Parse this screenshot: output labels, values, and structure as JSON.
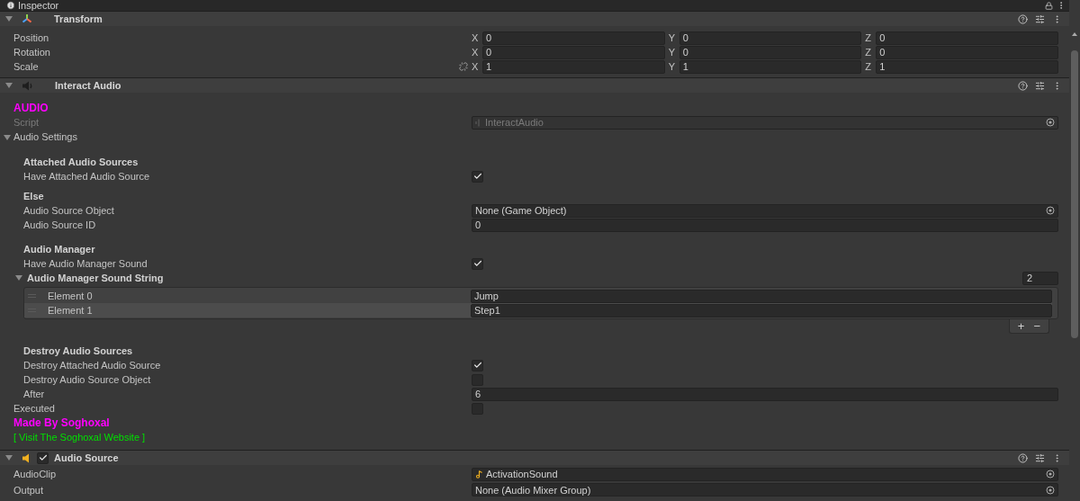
{
  "panel": {
    "title": "Inspector"
  },
  "components": [
    {
      "kind": "transform",
      "title": "Transform",
      "expanded": true,
      "vectors": [
        {
          "label": "Position",
          "linkable": false,
          "axes": [
            {
              "axis": "X",
              "value": "0"
            },
            {
              "axis": "Y",
              "value": "0"
            },
            {
              "axis": "Z",
              "value": "0"
            }
          ]
        },
        {
          "label": "Rotation",
          "linkable": false,
          "axes": [
            {
              "axis": "X",
              "value": "0"
            },
            {
              "axis": "Y",
              "value": "0"
            },
            {
              "axis": "Z",
              "value": "0"
            }
          ]
        },
        {
          "label": "Scale",
          "linkable": true,
          "axes": [
            {
              "axis": "X",
              "value": "1"
            },
            {
              "axis": "Y",
              "value": "1"
            },
            {
              "axis": "Z",
              "value": "1"
            }
          ]
        }
      ]
    },
    {
      "kind": "script",
      "title": "Interact Audio",
      "expanded": true,
      "items": [
        {
          "kind": "title",
          "text": "AUDIO"
        },
        {
          "kind": "script",
          "label": "Script",
          "value": "InteractAudio"
        },
        {
          "kind": "foldout",
          "label": "Audio Settings",
          "expanded": true,
          "children": [
            {
              "kind": "heading",
              "text": "Attached Audio Sources"
            },
            {
              "kind": "toggle",
              "label": "Have Attached Audio Source",
              "checked": true
            },
            {
              "kind": "heading",
              "text": "Else"
            },
            {
              "kind": "object",
              "label": "Audio Source Object",
              "value": "None (Game Object)"
            },
            {
              "kind": "field",
              "label": "Audio Source ID",
              "value": "0"
            },
            {
              "kind": "heading",
              "text": "Audio Manager"
            },
            {
              "kind": "toggle",
              "label": "Have Audio Manager Sound",
              "checked": true
            },
            {
              "kind": "list",
              "label": "Audio Manager Sound String",
              "expanded": true,
              "size": "2",
              "add": "+",
              "remove": "−",
              "elements": [
                {
                  "label": "Element 0",
                  "value": "Jump",
                  "selected": false
                },
                {
                  "label": "Element 1",
                  "value": "Step1",
                  "selected": true
                }
              ]
            },
            {
              "kind": "heading",
              "text": "Destroy Audio Sources"
            },
            {
              "kind": "toggle",
              "label": "Destroy Attached Audio Source",
              "checked": true
            },
            {
              "kind": "toggle",
              "label": "Destroy Audio Source Object",
              "checked": false
            },
            {
              "kind": "field",
              "label": "After",
              "value": "6"
            }
          ]
        },
        {
          "kind": "toggle",
          "label": "Executed",
          "checked": false
        },
        {
          "kind": "title",
          "text": "Made By Soghoxal"
        },
        {
          "kind": "link",
          "text": "[ Visit The Soghoxal Website ]"
        }
      ]
    },
    {
      "kind": "audio",
      "title": "Audio Source",
      "expanded": true,
      "enabled": true,
      "items": [
        {
          "kind": "clip",
          "label": "AudioClip",
          "value": "ActivationSound"
        },
        {
          "kind": "object",
          "label": "Output",
          "value": "None (Audio Mixer Group)"
        }
      ]
    }
  ]
}
